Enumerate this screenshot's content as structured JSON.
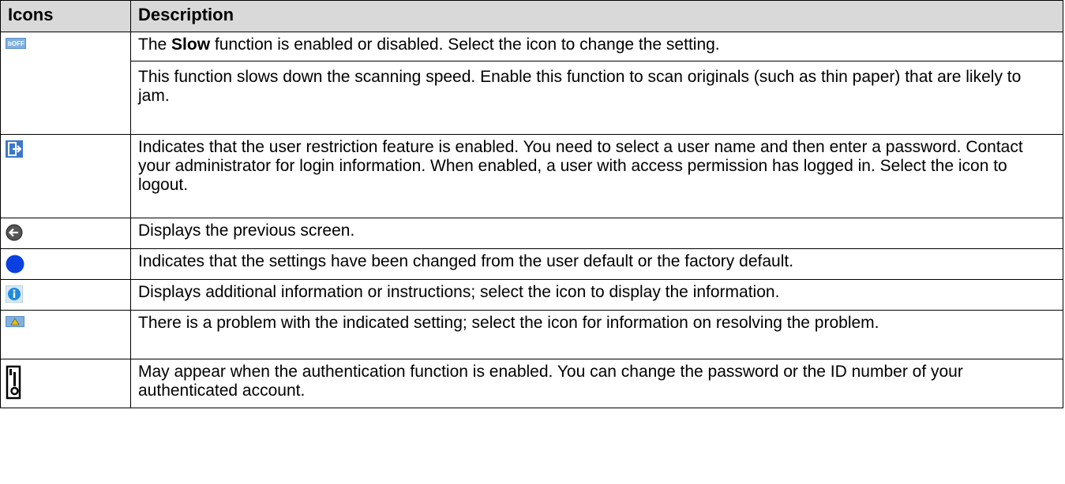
{
  "headers": {
    "icons": "Icons",
    "description": "Description"
  },
  "rows": [
    {
      "icon": "slow-icon",
      "desc_pre": "The ",
      "desc_bold": "Slow",
      "desc_post": " function is enabled or disabled. Select the icon to change the setting.",
      "desc2": "This function slows down the scanning speed. Enable this function to scan originals (such as thin paper) that are likely to jam."
    },
    {
      "icon": "logout-icon",
      "desc": "Indicates that the user restriction feature is enabled. You need to select a user name and then enter a password. Contact your administrator for login information. When enabled, a user with access permission has logged in. Select the icon to logout."
    },
    {
      "icon": "back-arrow-icon",
      "desc": "Displays the previous screen."
    },
    {
      "icon": "blue-dot-icon",
      "desc": "Indicates that the settings have been changed from the user default or the factory default."
    },
    {
      "icon": "info-icon",
      "desc": "Displays additional information or instructions; select the icon to display the information."
    },
    {
      "icon": "setting-problem-icon",
      "desc": "There is a problem with the indicated setting; select the icon for information on resolving the problem."
    },
    {
      "icon": "authentication-key-icon",
      "desc": "May appear when the authentication function is enabled. You can change the password or the ID number of your authenticated account."
    }
  ]
}
